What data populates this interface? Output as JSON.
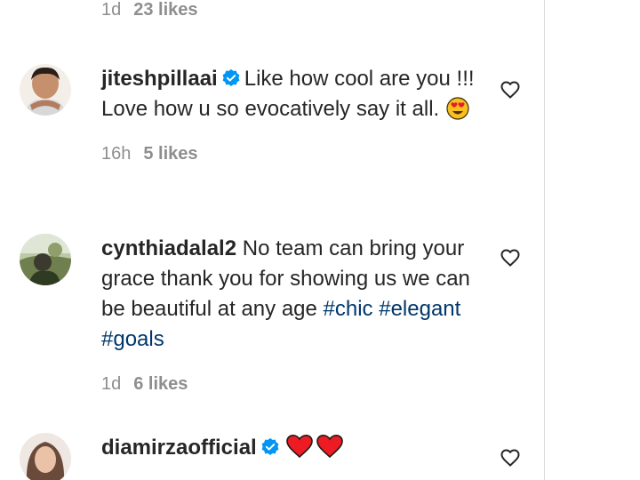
{
  "top_meta": {
    "time": "1d",
    "likes": "23 likes"
  },
  "comments": [
    {
      "username": "jiteshpillaai",
      "verified": true,
      "text": "Like how cool are you !!! Love how u so evocatively say it all.",
      "emoji": "heart-eyes-emoji",
      "time": "16h",
      "likes": "5 likes"
    },
    {
      "username": "cynthiadalal2",
      "verified": false,
      "text": "No team can bring your grace thank you for showing us we can be beautiful at any age",
      "hashtags": [
        "#chic",
        "#elegant",
        "#goals"
      ],
      "time": "1d",
      "likes": "6 likes"
    },
    {
      "username": "diamirzaofficial",
      "verified": true,
      "emoji": "red-heart-emoji x2"
    }
  ],
  "colors": {
    "text": "#262626",
    "meta": "#8e8e8e",
    "hashtag": "#00376b",
    "verified": "#0095f6",
    "red_heart": "#ed1b24"
  }
}
